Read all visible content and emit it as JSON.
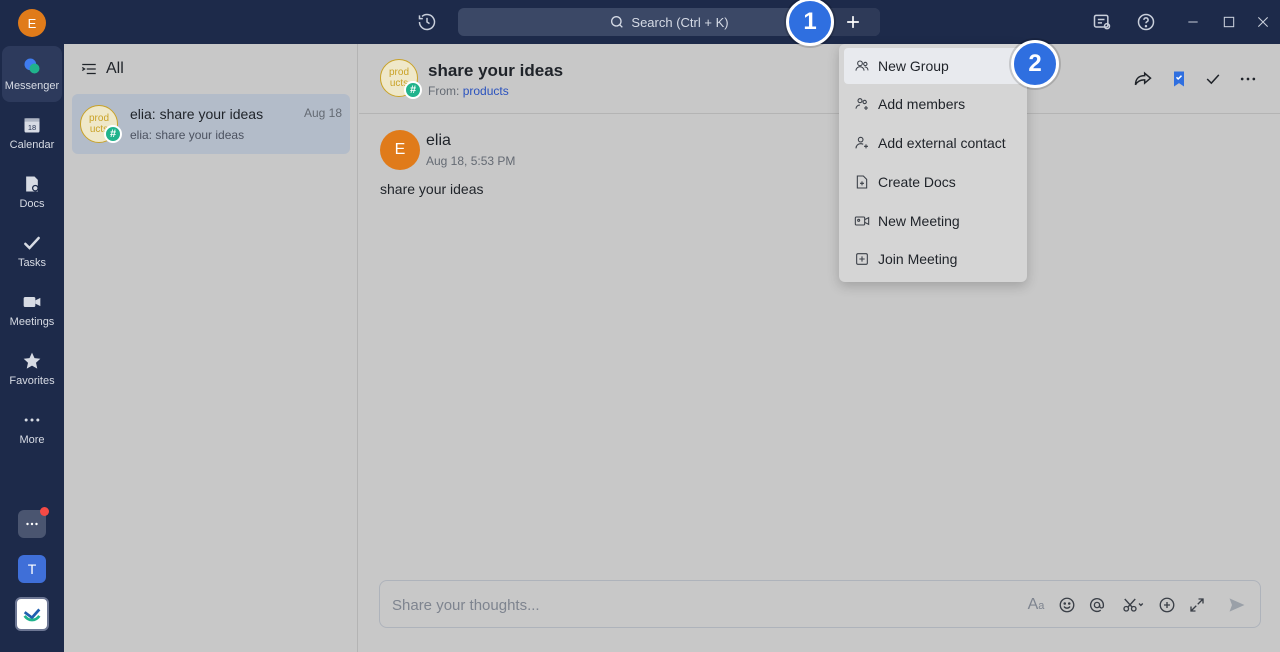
{
  "titlebar": {
    "user_initial": "E",
    "search_placeholder": "Search (Ctrl + K)",
    "icons": [
      "history-icon",
      "search-icon",
      "plus-icon",
      "inbox-icon",
      "help-icon",
      "minimize-icon",
      "maximize-icon",
      "close-icon"
    ]
  },
  "rail": {
    "items": [
      {
        "label": "Messenger",
        "icon": "messenger-icon"
      },
      {
        "label": "Calendar",
        "icon": "calendar-icon",
        "badge": "18"
      },
      {
        "label": "Docs",
        "icon": "docs-icon"
      },
      {
        "label": "Tasks",
        "icon": "tasks-icon"
      },
      {
        "label": "Meetings",
        "icon": "meetings-icon"
      },
      {
        "label": "Favorites",
        "icon": "star-icon"
      },
      {
        "label": "More",
        "icon": "more-icon"
      }
    ],
    "workspace_initial": "T"
  },
  "chat_list": {
    "filter_label": "All",
    "items": [
      {
        "avatar_text": "prod ucts",
        "title": "elia: share your ideas",
        "date": "Aug 18",
        "preview": "elia: share your ideas"
      }
    ]
  },
  "chat": {
    "title": "share your ideas",
    "from_label": "From:",
    "from_link": "products",
    "avatar_text": "prod ucts",
    "message": {
      "sender_initial": "E",
      "sender": "elia",
      "time": "Aug 18, 5:53 PM",
      "text": "share your ideas"
    },
    "composer_placeholder": "Share your thoughts..."
  },
  "menu": {
    "items": [
      {
        "label": "New Group",
        "icon": "group-icon"
      },
      {
        "label": "Add members",
        "icon": "add-members-icon"
      },
      {
        "label": "Add external contact",
        "icon": "add-contact-icon"
      },
      {
        "label": "Create Docs",
        "icon": "create-docs-icon"
      },
      {
        "label": "New Meeting",
        "icon": "video-icon"
      },
      {
        "label": "Join Meeting",
        "icon": "join-meeting-icon"
      }
    ]
  },
  "steps": [
    "1",
    "2"
  ],
  "colors": {
    "nav_bg": "#1d2a4a",
    "accent": "#2f6fe0",
    "badge_green": "#20b38c",
    "avatar_orange": "#e07b1a"
  }
}
